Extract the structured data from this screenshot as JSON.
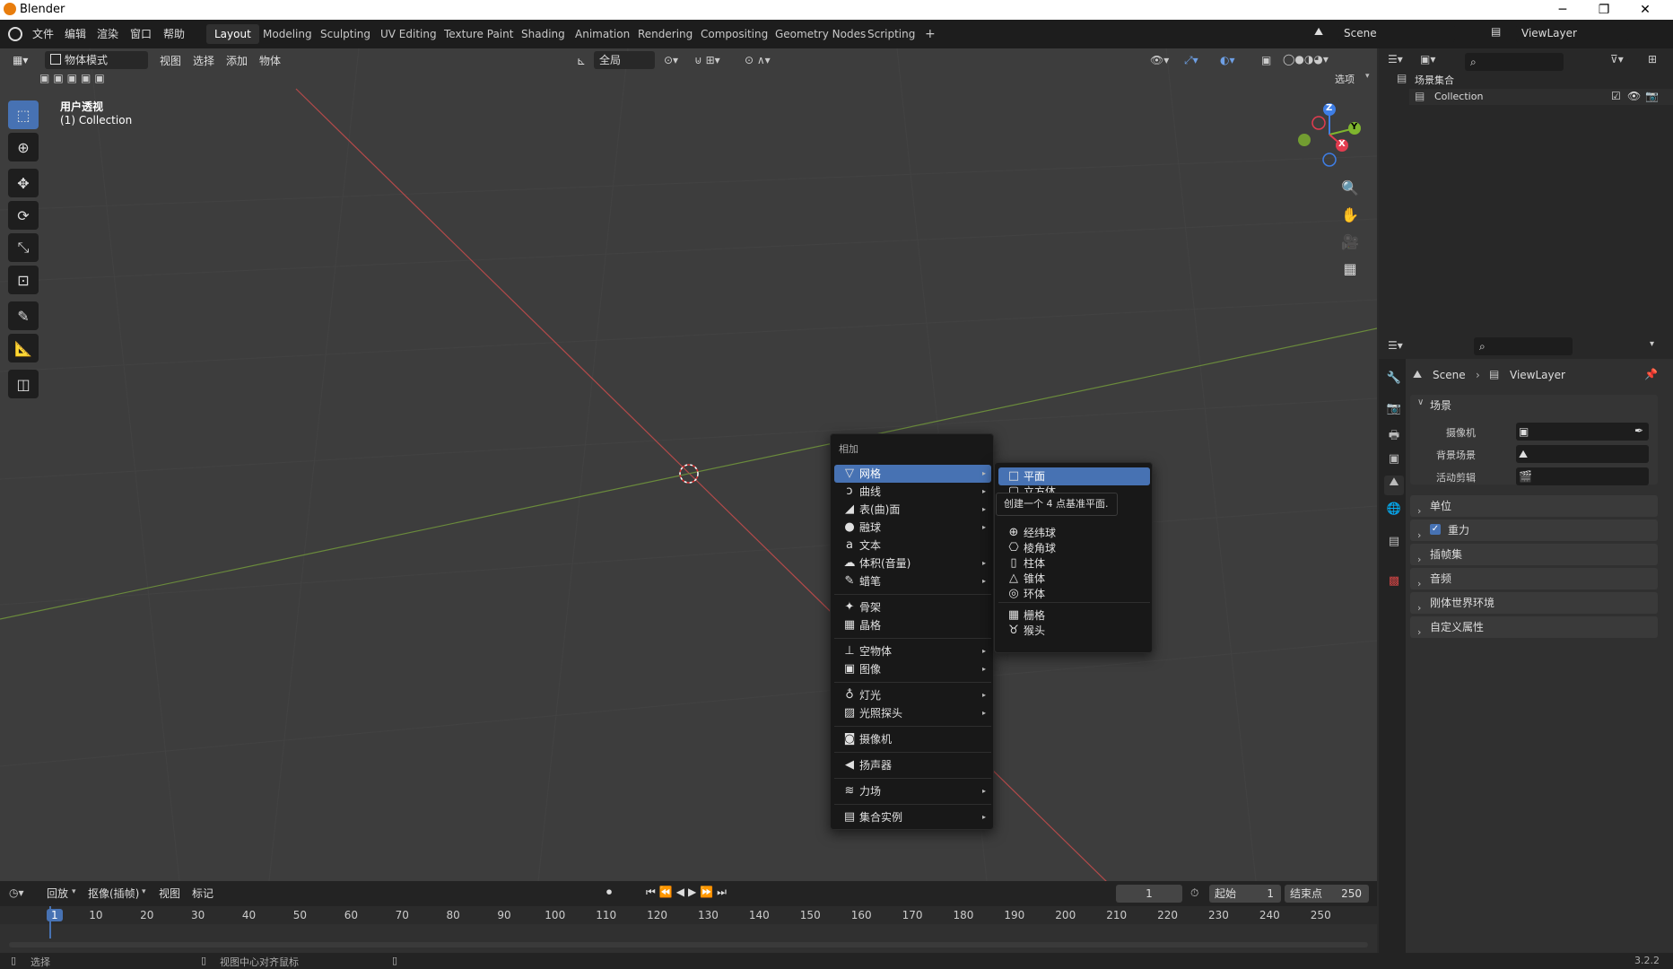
{
  "app": {
    "title": "Blender",
    "version": "3.2.2"
  },
  "window_controls": {
    "minimize": "─",
    "restore": "❐",
    "close": "✕"
  },
  "top_menu": [
    "文件",
    "编辑",
    "渲染",
    "窗口",
    "帮助"
  ],
  "workspaces": [
    "Layout",
    "Modeling",
    "Sculpting",
    "UV Editing",
    "Texture Paint",
    "Shading",
    "Animation",
    "Rendering",
    "Compositing",
    "Geometry Nodes",
    "Scripting"
  ],
  "workspace_add": "+",
  "scene_field": "Scene",
  "viewlayer_field": "ViewLayer",
  "viewport_header": {
    "mode": "物体模式",
    "menus": [
      "视图",
      "选择",
      "添加",
      "物体"
    ],
    "transform_orientation": "全局",
    "options_label": "选项"
  },
  "viewport": {
    "view_name": "用户透视",
    "collection_info": "(1) Collection"
  },
  "gizmo": {
    "z": "Z",
    "y": "Y",
    "x": "X"
  },
  "context_menu": {
    "title": "相加",
    "items": [
      {
        "label": "网格",
        "icon": "mesh-icon",
        "glyph": "▽",
        "submenu": true,
        "highlighted": true
      },
      {
        "label": "曲线",
        "icon": "curve-icon",
        "glyph": "ↄ",
        "submenu": true
      },
      {
        "label": "表(曲)面",
        "icon": "surface-icon",
        "glyph": "◢",
        "submenu": true
      },
      {
        "label": "融球",
        "icon": "metaball-icon",
        "glyph": "●",
        "submenu": true
      },
      {
        "label": "文本",
        "icon": "text-icon",
        "glyph": "a",
        "submenu": false
      },
      {
        "label": "体积(音量)",
        "icon": "volume-icon",
        "glyph": "☁",
        "submenu": true
      },
      {
        "label": "蜡笔",
        "icon": "grease-pencil-icon",
        "glyph": "✎",
        "submenu": true
      },
      {
        "label": "骨架",
        "icon": "armature-icon",
        "glyph": "✦",
        "submenu": false
      },
      {
        "label": "晶格",
        "icon": "lattice-icon",
        "glyph": "▦",
        "submenu": false
      },
      {
        "label": "空物体",
        "icon": "empty-icon",
        "glyph": "⊥",
        "submenu": true
      },
      {
        "label": "图像",
        "icon": "image-icon",
        "glyph": "▣",
        "submenu": true
      },
      {
        "label": "灯光",
        "icon": "light-icon",
        "glyph": "♁",
        "submenu": true
      },
      {
        "label": "光照探头",
        "icon": "light-probe-icon",
        "glyph": "▨",
        "submenu": true
      },
      {
        "label": "摄像机",
        "icon": "camera-icon",
        "glyph": "◙",
        "submenu": false
      },
      {
        "label": "扬声器",
        "icon": "speaker-icon",
        "glyph": "◀",
        "submenu": false
      },
      {
        "label": "力场",
        "icon": "force-field-icon",
        "glyph": "≋",
        "submenu": true
      },
      {
        "label": "集合实例",
        "icon": "collection-instance-icon",
        "glyph": "▤",
        "submenu": true
      }
    ]
  },
  "mesh_submenu": {
    "items": [
      {
        "label": "平面",
        "icon": "plane-icon",
        "glyph": "□",
        "highlighted": true
      },
      {
        "label": "立方体",
        "icon": "cube-icon",
        "glyph": "▢"
      },
      {
        "label": "经纬球",
        "icon": "uv-sphere-icon",
        "glyph": "⊕"
      },
      {
        "label": "棱角球",
        "icon": "ico-sphere-icon",
        "glyph": "⎔"
      },
      {
        "label": "柱体",
        "icon": "cylinder-icon",
        "glyph": "▯"
      },
      {
        "label": "锥体",
        "icon": "cone-icon",
        "glyph": "△"
      },
      {
        "label": "环体",
        "icon": "torus-icon",
        "glyph": "◎"
      },
      {
        "label": "栅格",
        "icon": "grid-icon",
        "glyph": "▦"
      },
      {
        "label": "猴头",
        "icon": "monkey-icon",
        "glyph": "♉"
      }
    ],
    "tooltip": "创建一个 4 点基准平面."
  },
  "outliner": {
    "root": "场景集合",
    "collection": "Collection"
  },
  "properties": {
    "breadcrumb_scene": "Scene",
    "breadcrumb_viewlayer": "ViewLayer",
    "scene_panel": "场景",
    "fields": [
      {
        "label": "摄像机",
        "value": ""
      },
      {
        "label": "背景场景",
        "value": ""
      },
      {
        "label": "活动剪辑",
        "value": ""
      }
    ],
    "panels": [
      "单位",
      "重力",
      "插帧集",
      "音频",
      "刚体世界环境",
      "自定义属性"
    ],
    "gravity_checked": true
  },
  "timeline": {
    "menus": [
      "回放",
      "抠像(插帧)",
      "视图",
      "标记"
    ],
    "current_frame": "1",
    "start_label": "起始",
    "start_value": "1",
    "end_label": "结束点",
    "end_value": "250",
    "ticks": [
      "1",
      "10",
      "20",
      "30",
      "40",
      "50",
      "60",
      "70",
      "80",
      "90",
      "100",
      "110",
      "120",
      "130",
      "140",
      "150",
      "160",
      "170",
      "180",
      "190",
      "200",
      "210",
      "220",
      "230",
      "240",
      "250"
    ]
  },
  "statusbar": {
    "left": "选择",
    "middle": "视图中心对齐鼠标",
    "version": "3.2.2"
  }
}
